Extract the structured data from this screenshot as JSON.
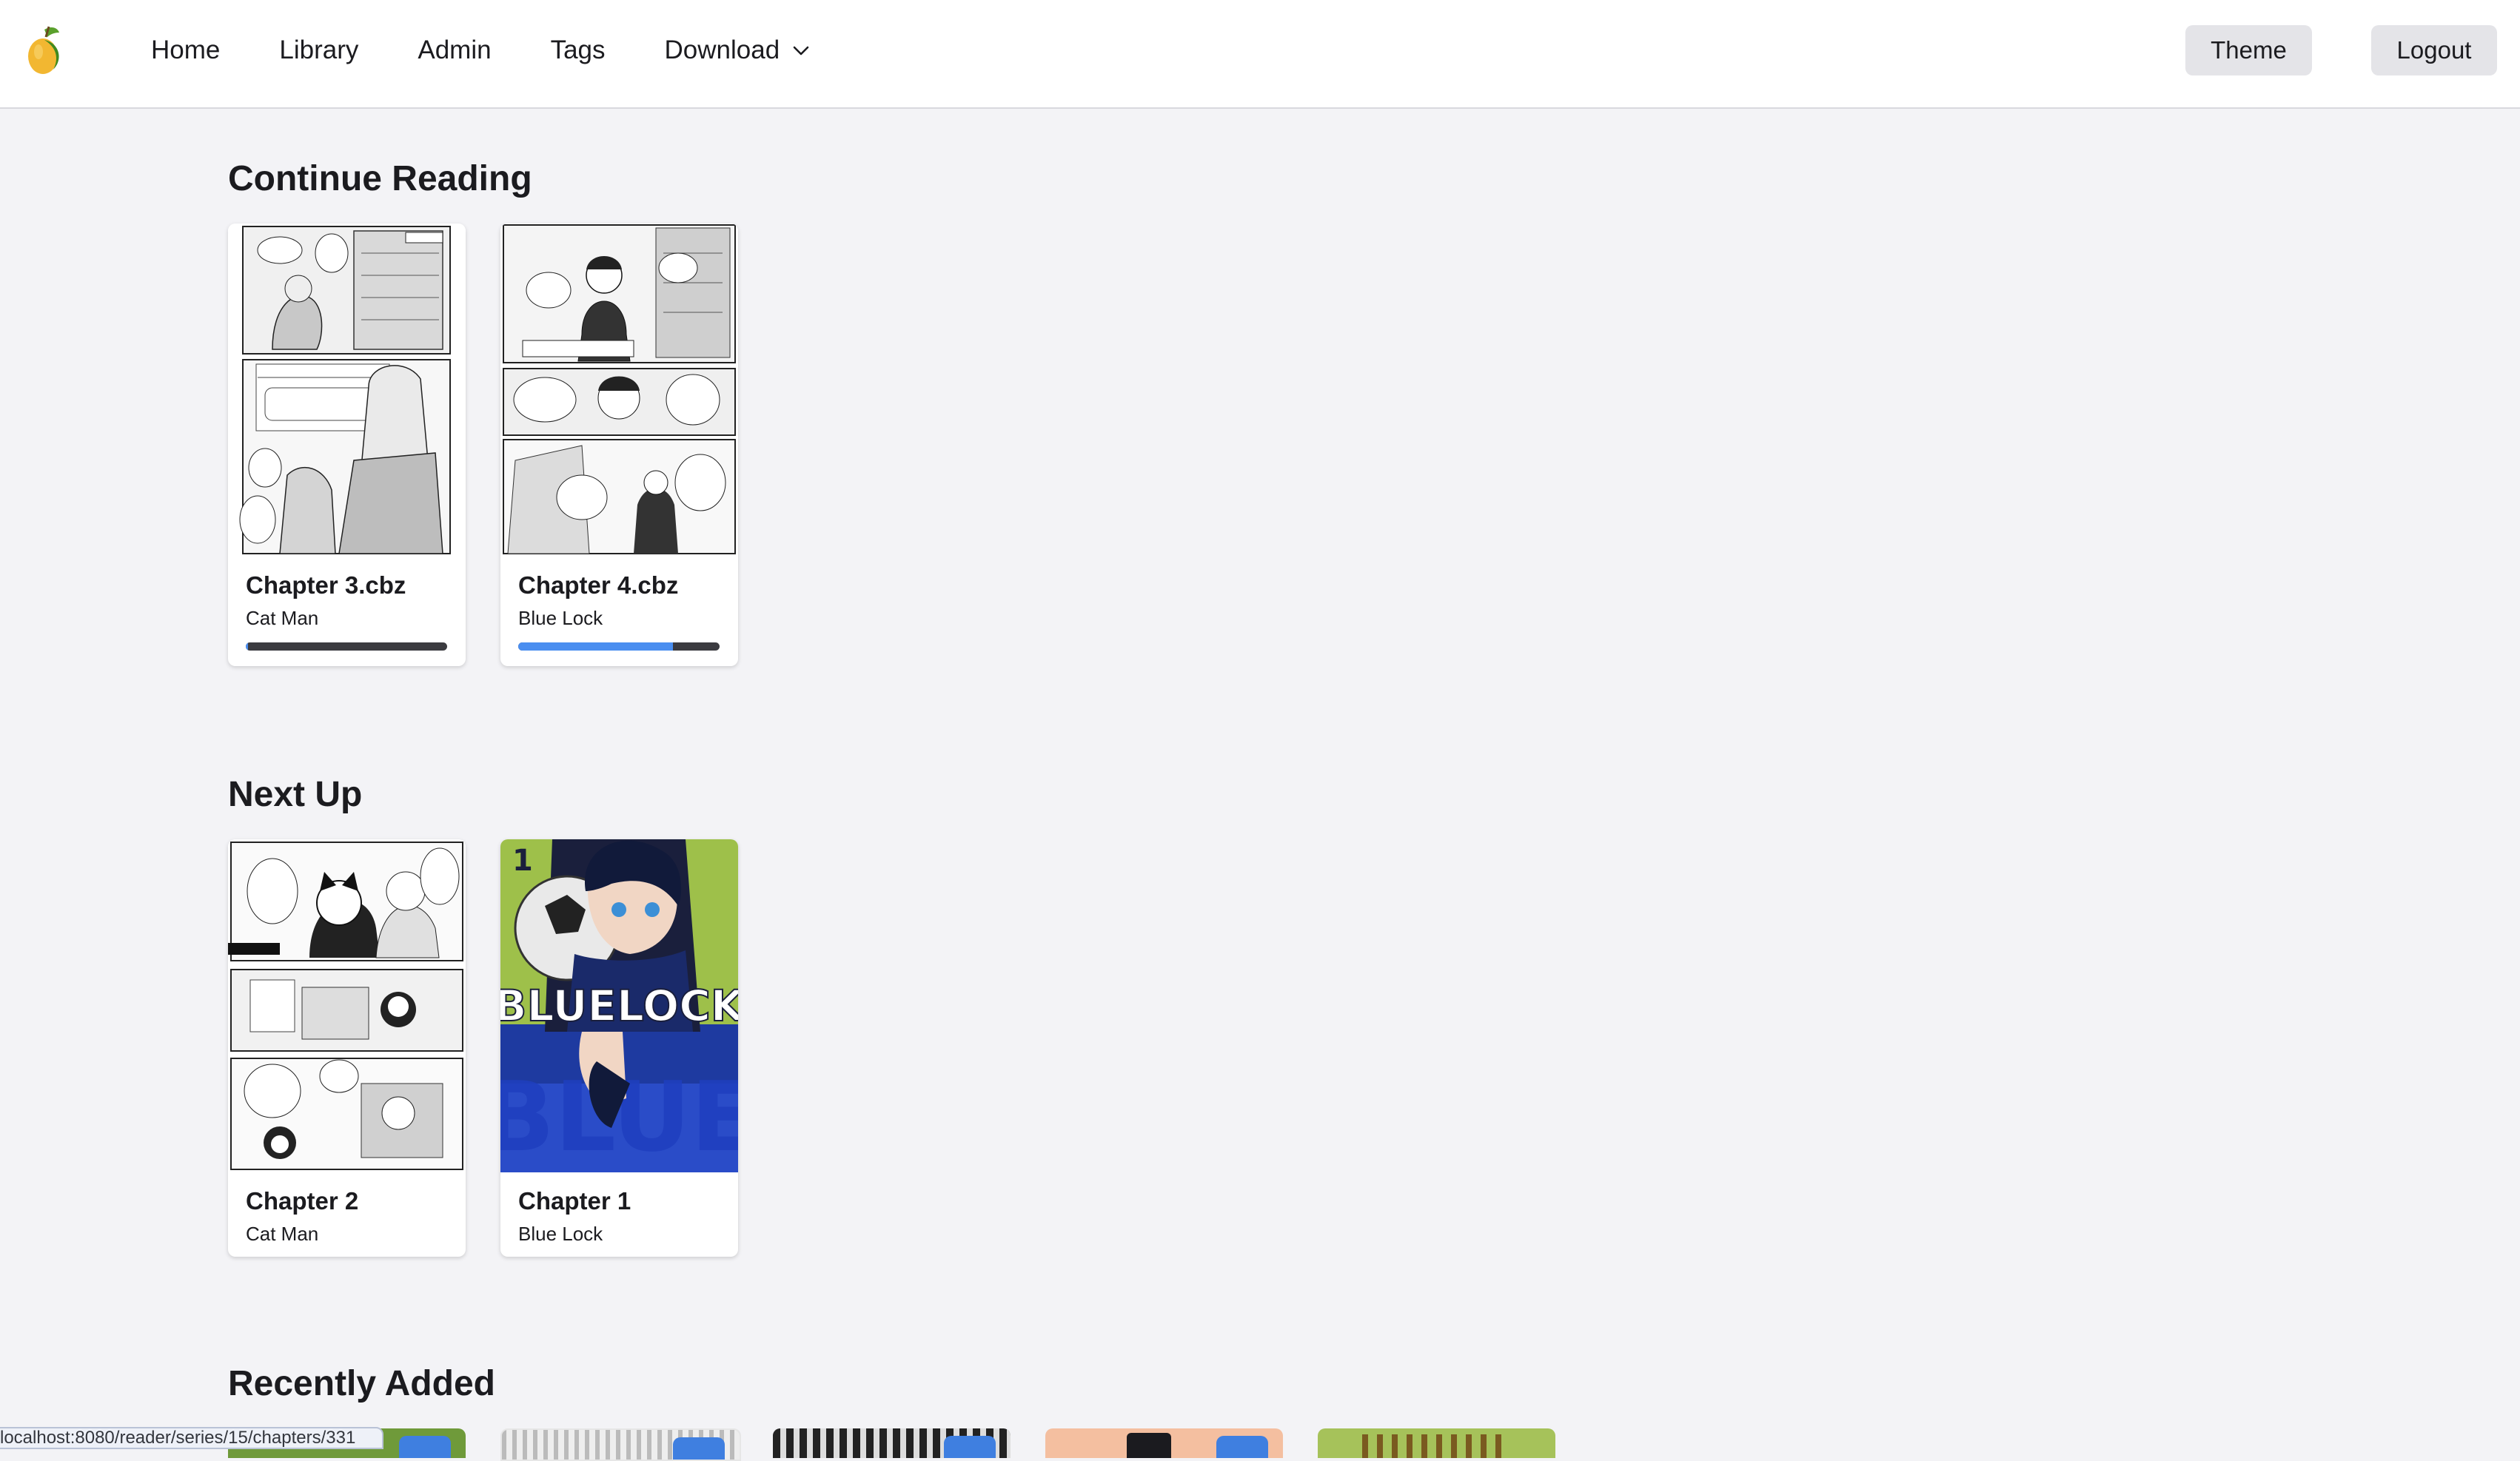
{
  "nav": {
    "links": {
      "home": "Home",
      "library": "Library",
      "admin": "Admin",
      "tags": "Tags",
      "download": "Download"
    },
    "theme_label": "Theme",
    "logout_label": "Logout"
  },
  "continue_reading": {
    "title": "Continue Reading",
    "items": [
      {
        "title": "Chapter 3.cbz",
        "series": "Cat Man",
        "progress": 0.01
      },
      {
        "title": "Chapter 4.cbz",
        "series": "Blue Lock",
        "progress": 0.77
      }
    ]
  },
  "next_up": {
    "title": "Next Up",
    "items": [
      {
        "title": "Chapter 2",
        "series": "Cat Man"
      },
      {
        "title": "Chapter 1",
        "series": "Blue Lock"
      }
    ]
  },
  "recently_added": {
    "title": "Recently Added"
  },
  "status_url": "localhost:8080/reader/series/15/chapters/331",
  "colors": {
    "background": "#f3f3f6",
    "progress_fill": "#4a8ef0",
    "progress_track": "#3b3b40",
    "button_bg": "#e4e4e8"
  },
  "icons": [
    "mango-logo-icon",
    "chevron-down-icon"
  ]
}
